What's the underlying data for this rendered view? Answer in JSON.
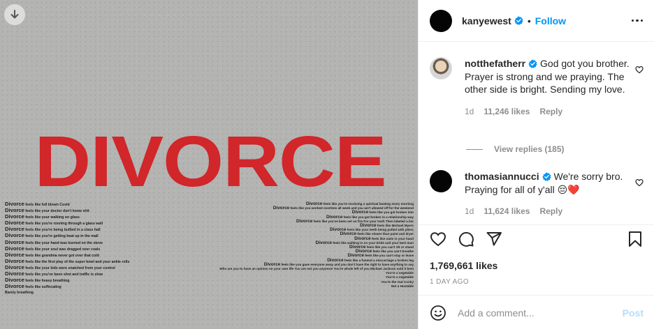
{
  "post": {
    "username": "kanyewest",
    "follow_label": "Follow",
    "separator": "•",
    "image_title": "DIVORCE",
    "left_lines": [
      {
        "kw": "Divorce",
        "rest": " feels like full blown Covid"
      },
      {
        "kw": "Divorce",
        "rest": " feels like your doctor don't know shit"
      },
      {
        "kw": "Divorce",
        "rest": " feels like your walking on glass"
      },
      {
        "kw": "Divorce",
        "rest": " feels like you're running through a glass wall"
      },
      {
        "kw": "Divorce",
        "rest": " feels like you're being bullied in a class hall"
      },
      {
        "kw": "Divorce",
        "rest": " feels like you're getting beat up in the mall"
      },
      {
        "kw": "Divorce",
        "rest": " feels like your hand was burned on the stove"
      },
      {
        "kw": "Divorce",
        "rest": " feels like your soul was dragged over coals"
      },
      {
        "kw": "Divorce",
        "rest": " feels like grandma never got over that cold"
      },
      {
        "kw": "Divorce",
        "rest": " feels like the first play of the super bowl  and your ankle rolls"
      },
      {
        "kw": "Divorce",
        "rest": " feels like your kids were snatched from your control"
      },
      {
        "kw": "Divorce",
        "rest": " feels like you've been shot and traffic is slow"
      },
      {
        "kw": "Divorce",
        "rest": " feels like heavy breathing"
      },
      {
        "kw": "Divorce",
        "rest": " feels like suffocating"
      },
      {
        "kw": "",
        "rest": "Barely breathing"
      }
    ],
    "right_lines": [
      {
        "kw": "Divorce",
        "rest": " feels like you're receiving a spiritual beating every morning"
      },
      {
        "kw": "Divorce",
        "rest": " feels like you worked overtime all week and you ain't allowed off for the weekend"
      },
      {
        "kw": "Divorce",
        "rest": " feels like you got broken into"
      },
      {
        "kw": "Divorce",
        "rest": " feels like you got broken in a relationship way"
      },
      {
        "kw": "Divorce",
        "rest": " feels like you've been set on fire    For your truth    Then labeled a liar"
      },
      {
        "kw": "Divorce",
        "rest": " feels like Michael Myers"
      },
      {
        "kw": "Divorce",
        "rest": " feels like your teeth being pulled with pliers"
      },
      {
        "kw": "Divorce",
        "rest": " feels like slower than paint and dryer"
      },
      {
        "kw": "Divorce",
        "rest": " feels like nails in your hand"
      },
      {
        "kw": "Divorce",
        "rest": " feels like walking in on your bride and your best man"
      },
      {
        "kw": "Divorce",
        "rest": " feels like you can't   Sit or stand"
      },
      {
        "kw": "Divorce",
        "rest": " feels like you can't breathe"
      },
      {
        "kw": "Divorce",
        "rest": " feels like you can't stay or leave"
      },
      {
        "kw": "Divorce",
        "rest": " feels like a funeral a miscarriage a broken leg"
      },
      {
        "kw": "Divorce",
        "rest": " feels like you gave everyone away and you don't have the right to have anything to say"
      },
      {
        "kw": "",
        "rest": "Who are you to have an opinion on your own life    You are not you anymore    You're whole left of you    Michael Jackson sold it best"
      },
      {
        "kw": "",
        "rest": "You're a vegetable"
      },
      {
        "kw": "",
        "rest": "You're a vegetable"
      },
      {
        "kw": "",
        "rest": "You're the real Cosby"
      },
      {
        "kw": "",
        "rest": "Not a Huxtable"
      }
    ],
    "likes": "1,769,661 likes",
    "age": "1 DAY AGO",
    "add_comment_placeholder": "Add a comment...",
    "post_button": "Post"
  },
  "comments": [
    {
      "username": "notthefatherr",
      "text": "God got you brother. Prayer is strong and we praying. The other side is bright. Sending my love.",
      "time": "1d",
      "likes": "11,246 likes",
      "reply": "Reply"
    },
    {
      "username": "thomasiannucci",
      "text": "We're sorry bro. Praying for all of y'all 😔❤️",
      "time": "1d",
      "likes": "11,624 likes",
      "reply": "Reply"
    }
  ],
  "view_replies": "View replies (185)",
  "colors": {
    "accent": "#0095f6",
    "post_disabled": "#b2dffc",
    "divorce_red": "#d1262a",
    "muted": "#8e8e8e"
  },
  "icons": [
    "download-icon",
    "verified-badge-icon",
    "more-options-icon",
    "heart-icon",
    "comment-icon",
    "share-icon",
    "bookmark-icon",
    "emoji-icon"
  ]
}
